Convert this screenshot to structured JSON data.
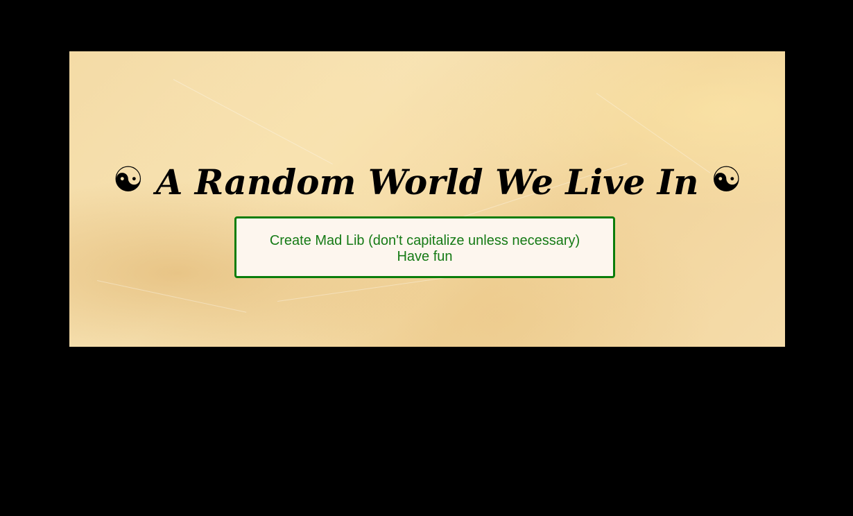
{
  "header": {
    "symbol_left": "☯",
    "title": "A Random World We Live In",
    "symbol_right": "☯"
  },
  "main": {
    "button_line1": "Create Mad Lib (don't capitalize unless necessary)",
    "button_line2": "Have fun"
  },
  "colors": {
    "background": "#000000",
    "parchment": "#f4dba6",
    "button_border": "#0a7d0a",
    "button_text": "#157a15",
    "button_fill": "#fdf6ee"
  },
  "icons": {
    "title_symbol": "yin-yang-icon"
  }
}
